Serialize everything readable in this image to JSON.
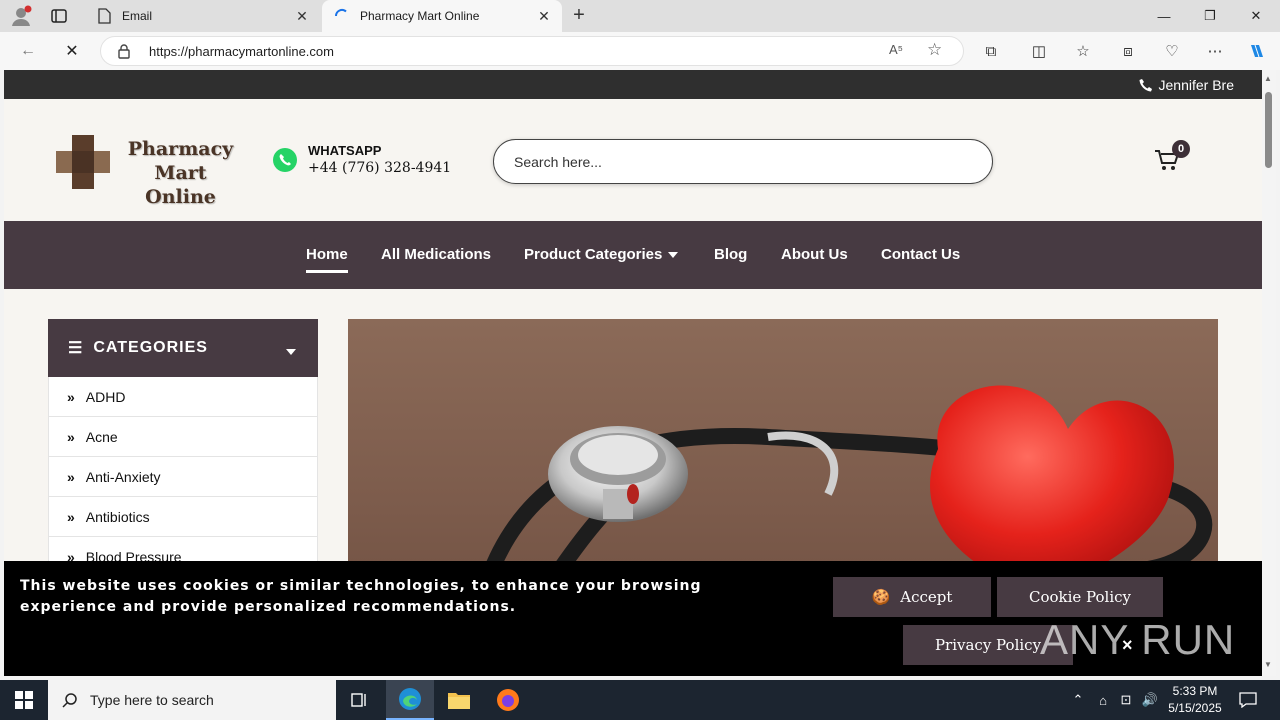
{
  "browser": {
    "tabs": [
      {
        "title": "Email",
        "active": false
      },
      {
        "title": "Pharmacy Mart Online",
        "active": true
      }
    ],
    "url": "https://pharmacymartonline.com",
    "read_aloud": "A⁵",
    "window_controls": {
      "minimize": "—",
      "restore": "❐",
      "close": "✕"
    }
  },
  "site": {
    "top_user": "Jennifer Bre",
    "logo_line1": "Pharmacy",
    "logo_line2": "Mart Online",
    "whatsapp_label": "WHATSAPP",
    "whatsapp_phone": "+44 (776) 328-4941",
    "search_placeholder": "Search here...",
    "cart_count": "0",
    "nav": [
      "Home",
      "All Medications",
      "Product Categories",
      "Blog",
      "About Us",
      "Contact Us"
    ],
    "categories_title": "CATEGORIES",
    "categories": [
      "ADHD",
      "Acne",
      "Anti-Anxiety",
      "Antibiotics",
      "Blood Pressure"
    ]
  },
  "cookie": {
    "text": "This website uses cookies or similar technologies, to enhance your browsing experience and provide personalized recommendations.",
    "accept": "Accept",
    "cookie_policy": "Cookie Policy",
    "privacy_policy": "Privacy Policy",
    "close": "×"
  },
  "watermark": "ANY RUN",
  "taskbar": {
    "search_placeholder": "Type here to search",
    "time": "5:33 PM",
    "date": "5/15/2025"
  },
  "colors": {
    "brand_dark": "#473a42",
    "topstrip": "#2f2f2f",
    "whatsapp": "#25d366",
    "taskbar": "#1c2530"
  }
}
